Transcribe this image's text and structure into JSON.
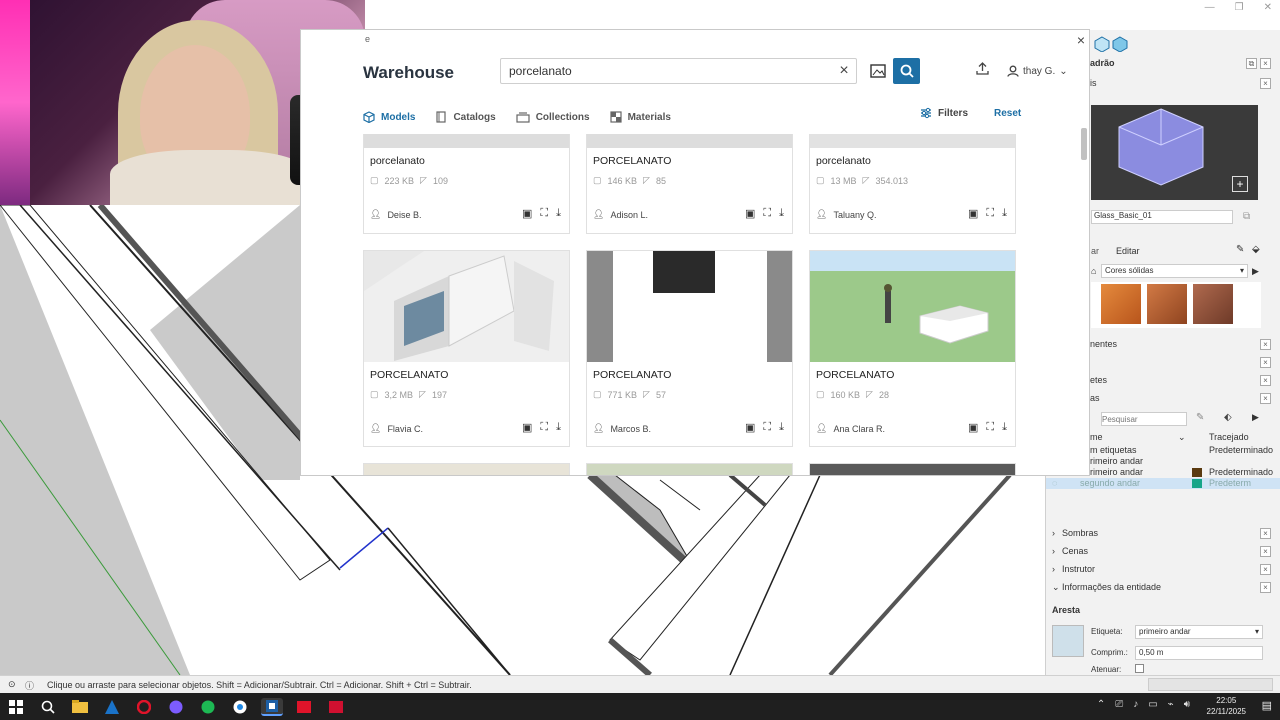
{
  "app": {
    "title_fragment": "e",
    "window_controls": [
      "—",
      "❐",
      "✕"
    ]
  },
  "warehouse": {
    "logo": "Warehouse",
    "close": "×",
    "search": {
      "value": "porcelanato",
      "clear": "×"
    },
    "user": {
      "name": "thay G.",
      "chevron": "⌄"
    },
    "tabs": [
      {
        "label": "Models",
        "icon": "cube-icon",
        "active": true
      },
      {
        "label": "Catalogs",
        "icon": "catalog-icon",
        "active": false
      },
      {
        "label": "Collections",
        "icon": "collection-icon",
        "active": false
      },
      {
        "label": "Materials",
        "icon": "material-icon",
        "active": false
      }
    ],
    "filters_label": "Filters",
    "reset_label": "Reset",
    "cards": [
      {
        "title": "porcelanato",
        "size": "223 KB",
        "count": "109",
        "author": "Deise B."
      },
      {
        "title": "PORCELANATO",
        "size": "146 KB",
        "count": "85",
        "author": "Adison L."
      },
      {
        "title": "porcelanato",
        "size": "13 MB",
        "count": "354.013",
        "author": "Taluany Q."
      },
      {
        "title": "PORCELANATO",
        "size": "3,2 MB",
        "count": "197",
        "author": "Flavia C."
      },
      {
        "title": "PORCELANATO",
        "size": "771 KB",
        "count": "57",
        "author": "Marcos B."
      },
      {
        "title": "PORCELANATO",
        "size": "160 KB",
        "count": "28",
        "author": "Ana Clara R."
      }
    ]
  },
  "panel": {
    "title": "adrão",
    "materials_label": "is",
    "material_name": "Glass_Basic_01",
    "tabs": [
      "ar",
      "Editar"
    ],
    "library": "Cores sólidas",
    "tray_items": [
      {
        "label": "nentes"
      },
      {
        "label": "etes"
      },
      {
        "label": "as"
      }
    ],
    "tags_search_placeholder": "Pesquisar",
    "tags_header": {
      "name": "me",
      "dash": "Tracejado"
    },
    "tags": [
      {
        "name": "m etiquetas",
        "dash": "Predeterminado",
        "color": ""
      },
      {
        "name": "rimeiro andar",
        "dash": "",
        "color": ""
      },
      {
        "name": "rimeiro andar",
        "dash": "Predeterminado",
        "color": "#5a3a10"
      },
      {
        "name": "segundo andar",
        "dash": "Predeterm",
        "color": "#17a589"
      }
    ],
    "sections": [
      "Sombras",
      "Cenas",
      "Instrutor",
      "Informações da entidade"
    ],
    "entity": {
      "type": "Aresta",
      "tag_label": "Etiqueta:",
      "tag_value": "primeiro andar",
      "length_label": "Comprim.:",
      "length_value": "0,50 m",
      "soft_label": "Atenuar:"
    }
  },
  "status": {
    "text": "Clique ou arraste para selecionar objetos. Shift = Adicionar/Subtrair. Ctrl = Adicionar. Shift + Ctrl = Subtrair."
  },
  "taskbar": {
    "time": "22:05",
    "date": "22/11/2025"
  },
  "colors": {
    "accent": "#1d6fa5",
    "tag_brown": "#5a3a10",
    "tag_teal": "#17a589"
  }
}
